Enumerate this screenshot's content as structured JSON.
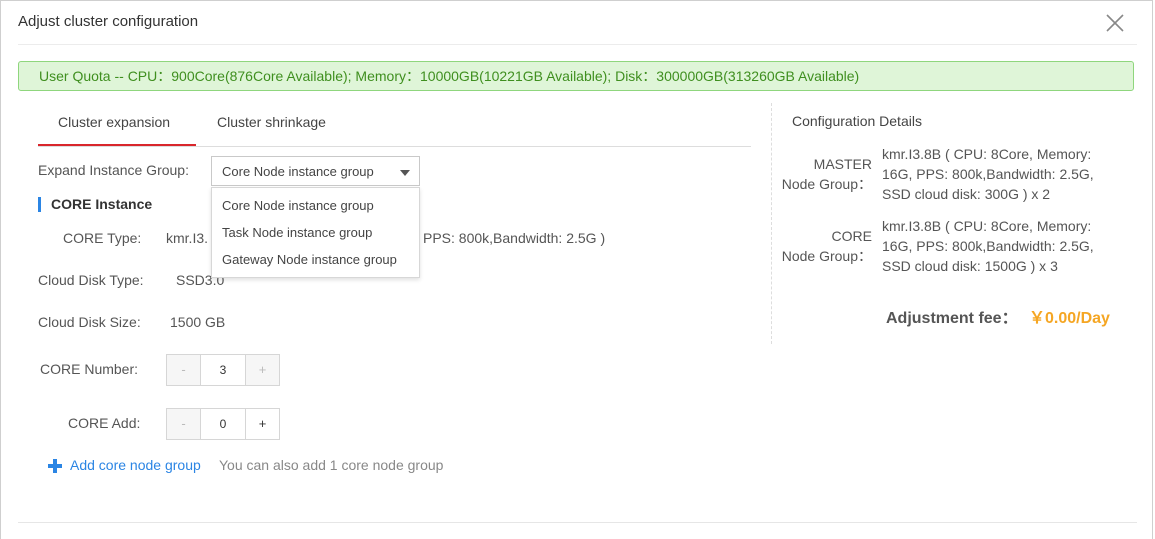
{
  "dialog": {
    "title": "Adjust cluster configuration"
  },
  "quota": {
    "text": "User Quota -- CPU：900Core(876Core Available); Memory：10000GB(10221GB Available); Disk：300000GB(313260GB Available)"
  },
  "tabs": [
    {
      "label": "Cluster expansion",
      "active": true
    },
    {
      "label": "Cluster shrinkage",
      "active": false
    }
  ],
  "expand_group": {
    "label": "Expand Instance Group:",
    "selected": "Core Node instance group",
    "options": [
      "Core Node instance group",
      "Task Node instance group",
      "Gateway Node instance group"
    ]
  },
  "section": {
    "title": "CORE Instance"
  },
  "core_type": {
    "label": "CORE Type:",
    "value_start": "kmr.I3.",
    "value_end": "PPS: 800k,Bandwidth: 2.5G )"
  },
  "cloud_disk_type": {
    "label": "Cloud Disk Type:",
    "value": "SSD3.0"
  },
  "cloud_disk_size": {
    "label": "Cloud Disk Size:",
    "value": "1500 GB"
  },
  "core_number": {
    "label": "CORE Number:",
    "value": "3",
    "minus": "-",
    "plus": "+"
  },
  "core_add": {
    "label": "CORE Add:",
    "value": "0",
    "minus": "-",
    "plus": "+"
  },
  "add_group": {
    "link": "Add core node group",
    "hint": "You can also add 1 core node group"
  },
  "details": {
    "title": "Configuration Details",
    "groups": [
      {
        "name_line1": "MASTER",
        "name_line2": "Node Group：",
        "desc_lines": [
          "kmr.I3.8B ( CPU: 8Core, Memory:",
          "16G, PPS: 800k,Bandwidth: 2.5G,",
          "SSD cloud disk: 300G ) x 2"
        ]
      },
      {
        "name_line1": "CORE",
        "name_line2": "Node Group：",
        "desc_lines": [
          "kmr.I3.8B ( CPU: 8Core, Memory:",
          "16G, PPS: 800k,Bandwidth: 2.5G,",
          "SSD cloud disk: 1500G ) x 3"
        ]
      }
    ],
    "fee_label": "Adjustment fee：",
    "fee_value": "￥0.00/Day"
  },
  "colors": {
    "accent_blue": "#2b85e4",
    "tab_red": "#d9262c",
    "quota_green": "#3f8f1f",
    "fee_orange": "#f5a623"
  }
}
